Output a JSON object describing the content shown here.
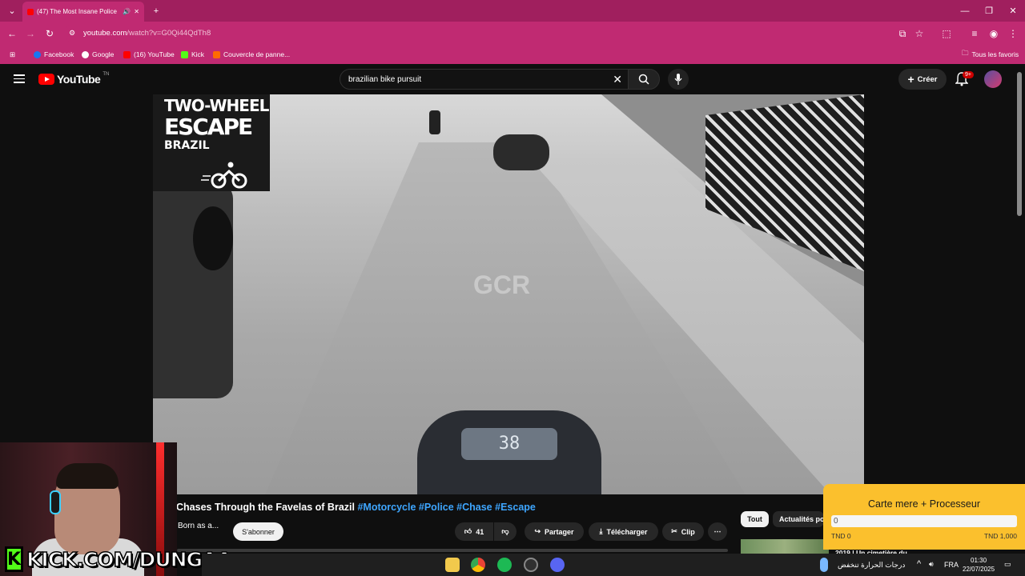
{
  "browser": {
    "tab_title": "(47) The Most Insane Police",
    "url_host": "youtube.com",
    "url_path": "/watch?v=G0Qi44QdTh8",
    "bookmarks": [
      "Facebook",
      "Google",
      "(16) YouTube",
      "Kick",
      "Couvercle de panne...",
      "Tous les favoris"
    ]
  },
  "youtube": {
    "logo_text": "YouTube",
    "logo_region": "TN",
    "search_value": "brazilian bike pursuit",
    "create_label": "Créer",
    "notif_badge": "9+"
  },
  "video": {
    "overlay_line1": "TWO-WHEEL",
    "overlay_line2": "ESCAPE",
    "overlay_line3": "BRAZIL",
    "speedo": "38",
    "watermark": "GCR"
  },
  "meta": {
    "title_plain": "Chases Through the Favelas of Brazil ",
    "tags": [
      "#Motorcycle",
      "#Police",
      "#Chase",
      "#Escape"
    ],
    "channel": "Born as a...",
    "subscribe_label": "S'abonner",
    "like_count": "41",
    "share_label": "Partager",
    "download_label": "Télécharger",
    "clip_label": "Clip",
    "more_label": "⋯",
    "chips": [
      "Tout",
      "Actualités po"
    ],
    "suggestion_title": "2019 | Un cimetière du"
  },
  "overlay": {
    "kick_text": "KICK.COM/DUNGAA",
    "kick_letter": "K",
    "goal_title": "Carte mere + Processeur",
    "goal_value": "0",
    "goal_min": "TND 0",
    "goal_max": "TND 1,000"
  },
  "taskbar": {
    "weather": "درجات الحرارة تنخفض",
    "lang": "FRA",
    "time": "01:30",
    "date": "22/07/2025"
  }
}
